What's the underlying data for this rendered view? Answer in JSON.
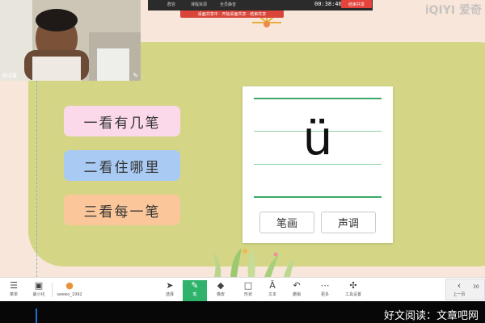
{
  "top_bar": {
    "items": [
      "群容",
      "课程资源",
      "全员静音"
    ],
    "timer": "00:38:46",
    "end_share_label": "结束共享",
    "notice": "桌面共享中 · 开始桌面共享 · 结束共享"
  },
  "watermark": "iQIYI 爱奇",
  "webcam": {
    "name": "杨洁雅"
  },
  "lesson": {
    "steps": [
      "一看有几笔",
      "二看住哪里",
      "三看每一笔"
    ],
    "letter": "ü",
    "buttons": [
      "笔画",
      "声调"
    ]
  },
  "toolbar": {
    "left": [
      {
        "icon": "menu-icon",
        "glyph": "☰",
        "label": "菜单"
      },
      {
        "icon": "minimize-icon",
        "glyph": "▣",
        "label": "最小化"
      },
      {
        "icon": "user-avatar-icon",
        "glyph": "●",
        "label": "seewo_1992"
      }
    ],
    "tools": [
      {
        "icon": "cursor-icon",
        "glyph": "➤",
        "label": "选择"
      },
      {
        "icon": "pen-icon",
        "glyph": "✎",
        "label": "笔"
      },
      {
        "icon": "eraser-icon",
        "glyph": "◆",
        "label": "橡皮"
      },
      {
        "icon": "shape-icon",
        "glyph": "□",
        "label": "形状"
      },
      {
        "icon": "text-icon",
        "glyph": "Ā",
        "label": "文本"
      },
      {
        "icon": "undo-icon",
        "glyph": "↶",
        "label": "撤销"
      },
      {
        "icon": "more-icon",
        "glyph": "⋯",
        "label": "更多"
      },
      {
        "icon": "settings-icon",
        "glyph": "✣",
        "label": "工具设置"
      }
    ],
    "page": {
      "prev_label": "上一页",
      "page_number": "30"
    }
  },
  "caption": "好文阅读：文章吧网",
  "colors": {
    "canvas": "#f9e6da",
    "panel": "#d4d686",
    "pill_pink": "#fbd9ea",
    "pill_blue": "#a9cbf3",
    "pill_orange": "#fbc79a",
    "active_tool": "#2fb36b",
    "line_green": "#3aa866"
  }
}
